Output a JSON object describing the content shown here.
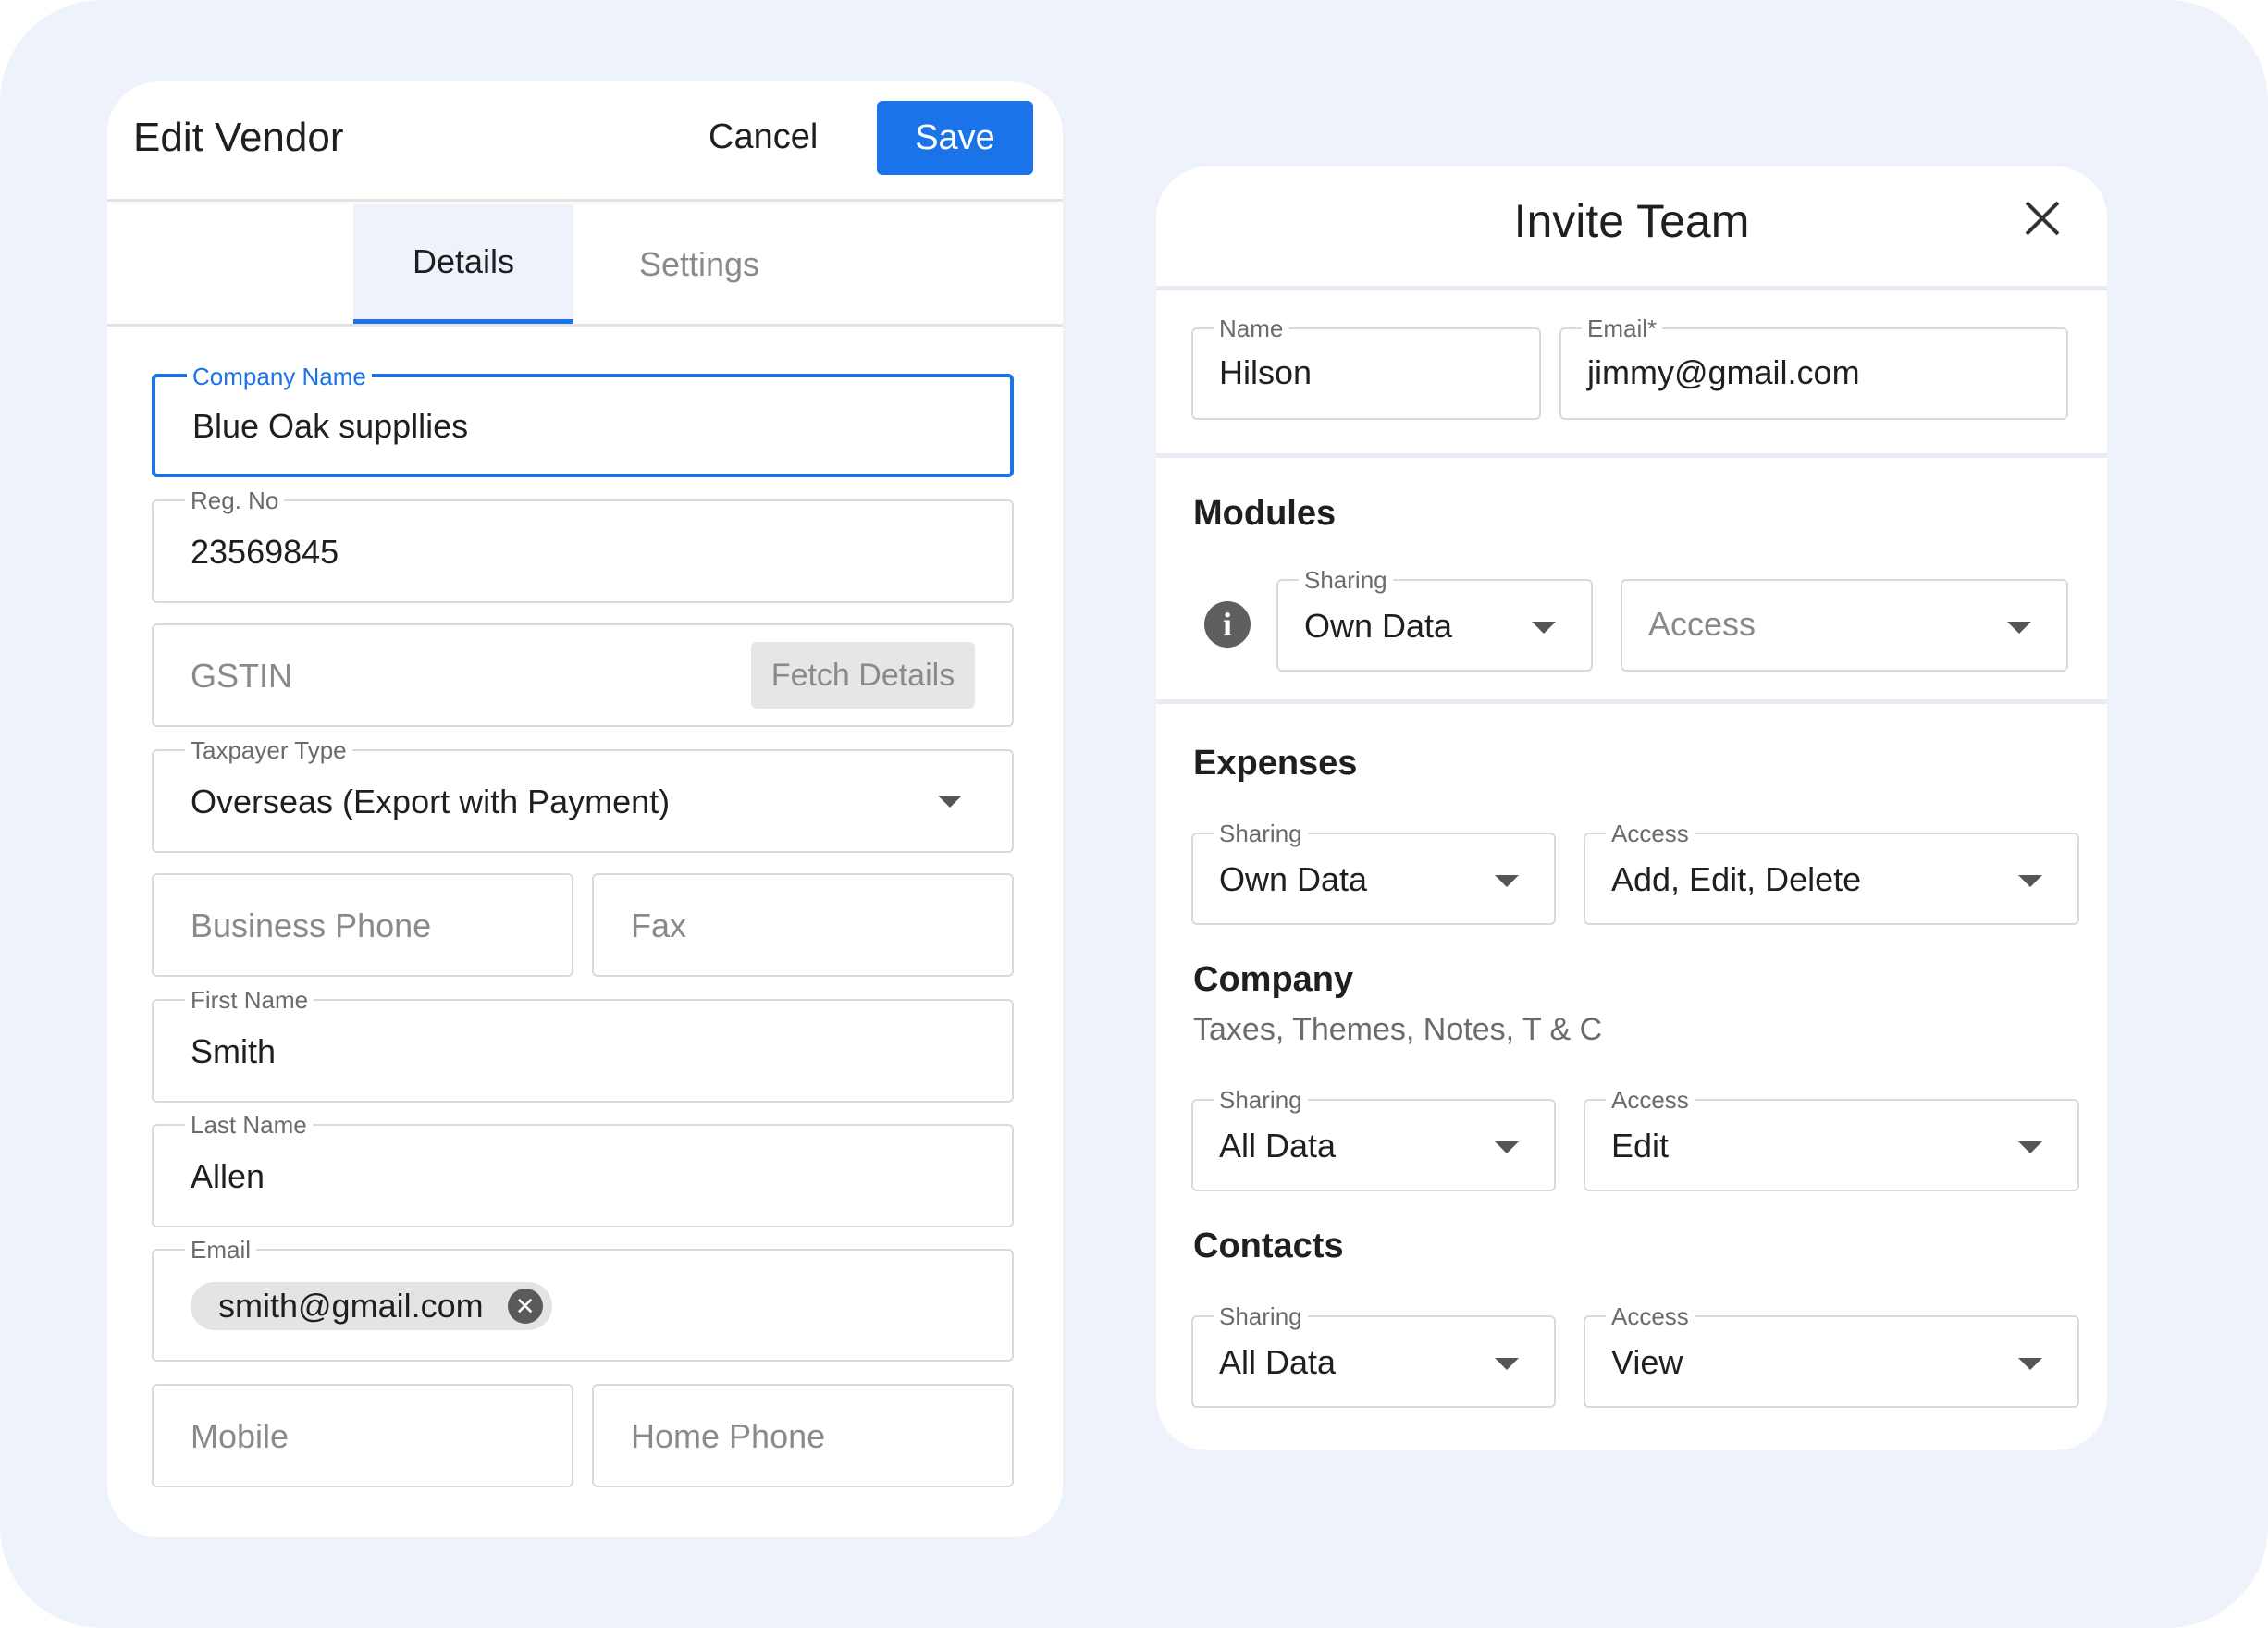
{
  "vendor": {
    "title": "Edit Vendor",
    "cancel_label": "Cancel",
    "save_label": "Save",
    "tabs": [
      "Details",
      "Settings"
    ],
    "company_name": {
      "label": "Company Name",
      "value": "Blue Oak suppllies"
    },
    "reg_no": {
      "label": "Reg. No",
      "value": "23569845"
    },
    "gstin": {
      "placeholder": "GSTIN",
      "fetch_label": "Fetch Details"
    },
    "taxpayer_type": {
      "label": "Taxpayer Type",
      "value": "Overseas (Export with Payment)"
    },
    "business_phone": {
      "placeholder": "Business Phone"
    },
    "fax": {
      "placeholder": "Fax"
    },
    "first_name": {
      "label": "First Name",
      "value": "Smith"
    },
    "last_name": {
      "label": "Last Name",
      "value": "Allen"
    },
    "email": {
      "label": "Email",
      "chip": "smith@gmail.com"
    },
    "mobile": {
      "placeholder": "Mobile"
    },
    "home_phone": {
      "placeholder": "Home Phone"
    }
  },
  "team": {
    "title": "Invite Team",
    "name": {
      "label": "Name",
      "value": "Hilson"
    },
    "email": {
      "label": "Email*",
      "value": "jimmy@gmail.com"
    },
    "modules": {
      "title": "Modules",
      "sharing_label": "Sharing",
      "sharing_value": "Own Data",
      "access_placeholder": "Access"
    },
    "expenses": {
      "title": "Expenses",
      "sharing_label": "Sharing",
      "sharing_value": "Own Data",
      "access_label": "Access",
      "access_value": "Add, Edit, Delete"
    },
    "company": {
      "title": "Company",
      "subtitle": "Taxes, Themes, Notes, T & C",
      "sharing_label": "Sharing",
      "sharing_value": "All Data",
      "access_label": "Access",
      "access_value": "Edit"
    },
    "contacts": {
      "title": "Contacts",
      "sharing_label": "Sharing",
      "sharing_value": "All Data",
      "access_label": "Access",
      "access_value": "View"
    }
  },
  "colors": {
    "accent": "#1a73e8",
    "background": "#eef2fb",
    "border": "#dadada"
  }
}
